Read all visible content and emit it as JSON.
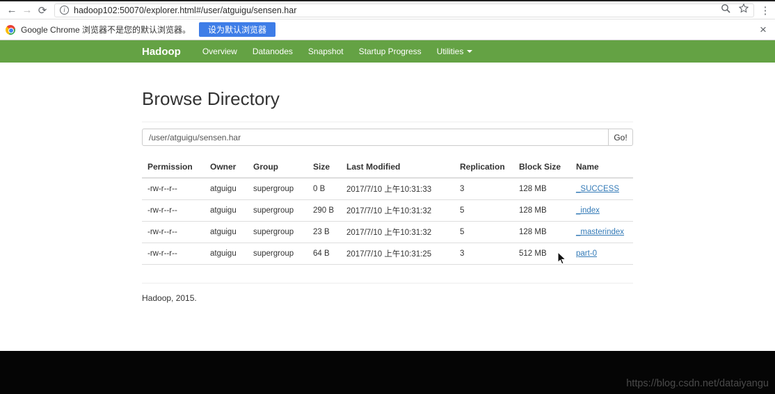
{
  "browser": {
    "url": "hadoop102:50070/explorer.html#/user/atguigu/sensen.har"
  },
  "notification": {
    "message": "Google Chrome 浏览器不是您的默认浏览器。",
    "button_label": "设为默认浏览器",
    "close_label": "×"
  },
  "navbar": {
    "brand": "Hadoop",
    "items": [
      "Overview",
      "Datanodes",
      "Snapshot",
      "Startup Progress",
      "Utilities"
    ]
  },
  "page": {
    "title": "Browse Directory",
    "path_value": "/user/atguigu/sensen.har",
    "go_label": "Go!"
  },
  "table": {
    "headers": [
      "Permission",
      "Owner",
      "Group",
      "Size",
      "Last Modified",
      "Replication",
      "Block Size",
      "Name"
    ],
    "rows": [
      {
        "permission": "-rw-r--r--",
        "owner": "atguigu",
        "group": "supergroup",
        "size": "0 B",
        "modified": "2017/7/10 上午10:31:33",
        "replication": "3",
        "block_size": "128 MB",
        "name": "_SUCCESS"
      },
      {
        "permission": "-rw-r--r--",
        "owner": "atguigu",
        "group": "supergroup",
        "size": "290 B",
        "modified": "2017/7/10 上午10:31:32",
        "replication": "5",
        "block_size": "128 MB",
        "name": "_index"
      },
      {
        "permission": "-rw-r--r--",
        "owner": "atguigu",
        "group": "supergroup",
        "size": "23 B",
        "modified": "2017/7/10 上午10:31:32",
        "replication": "5",
        "block_size": "128 MB",
        "name": "_masterindex"
      },
      {
        "permission": "-rw-r--r--",
        "owner": "atguigu",
        "group": "supergroup",
        "size": "64 B",
        "modified": "2017/7/10 上午10:31:25",
        "replication": "3",
        "block_size": "512 MB",
        "name": "part-0"
      }
    ]
  },
  "footer": {
    "text": "Hadoop, 2015."
  },
  "watermark": {
    "text": "https://blog.csdn.net/dataiyangu"
  },
  "colors": {
    "navbar_green": "#64a244",
    "button_blue": "#3e7de7",
    "link_blue": "#337ab7"
  }
}
